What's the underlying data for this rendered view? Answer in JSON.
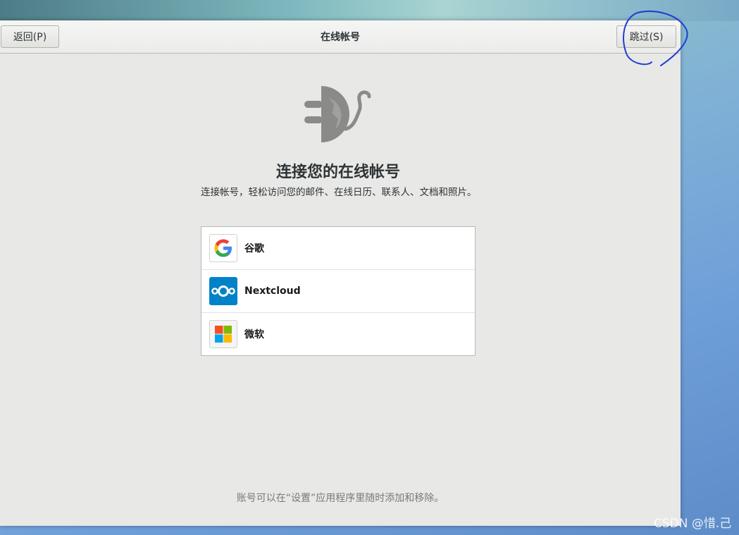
{
  "header": {
    "back_label": "返回(P)",
    "title": "在线帐号",
    "skip_label": "跳过(S)"
  },
  "main": {
    "hero_icon": "online-accounts-plug-icon",
    "heading": "连接您的在线帐号",
    "description": "连接帐号，轻松访问您的邮件、在线日历、联系人、文档和照片。",
    "providers": [
      {
        "label": "谷歌",
        "icon": "google-icon"
      },
      {
        "label": "Nextcloud",
        "icon": "nextcloud-icon"
      },
      {
        "label": "微软",
        "icon": "microsoft-icon"
      }
    ],
    "footer_note": "账号可以在“设置”应用程序里随时添加和移除。"
  },
  "watermark": "CSDN @惜.己",
  "colors": {
    "window_bg": "#e8e8e7",
    "annotation_ink": "#1f3fd1",
    "nextcloud_blue": "#0082c9"
  }
}
